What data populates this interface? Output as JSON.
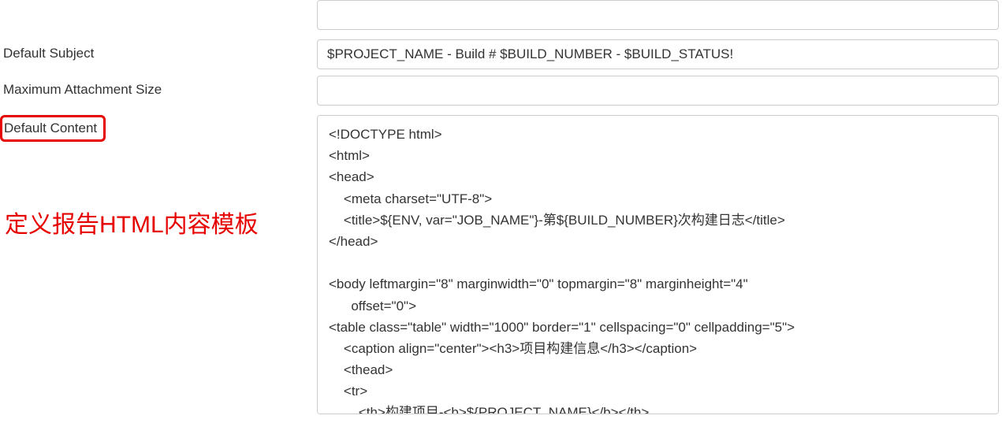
{
  "form": {
    "top_input": {
      "value": ""
    },
    "default_subject": {
      "label": "Default Subject",
      "value": "$PROJECT_NAME - Build # $BUILD_NUMBER - $BUILD_STATUS!"
    },
    "max_attachment_size": {
      "label": "Maximum Attachment Size",
      "value": ""
    },
    "default_content": {
      "label": "Default Content",
      "value": "<!DOCTYPE html>\n<html>\n<head>\n    <meta charset=\"UTF-8\">\n    <title>${ENV, var=\"JOB_NAME\"}-第${BUILD_NUMBER}次构建日志</title>\n</head>\n\n<body leftmargin=\"8\" marginwidth=\"0\" topmargin=\"8\" marginheight=\"4\"\n      offset=\"0\">\n<table class=\"table\" width=\"1000\" border=\"1\" cellspacing=\"0\" cellpadding=\"5\">\n    <caption align=\"center\"><h3>项目构建信息</h3></caption>\n    <thead>\n    <tr>\n        <th>构建项目-<b>${PROJECT_NAME}</b></th>"
    }
  },
  "annotation": {
    "text": "定义报告HTML内容模板"
  }
}
